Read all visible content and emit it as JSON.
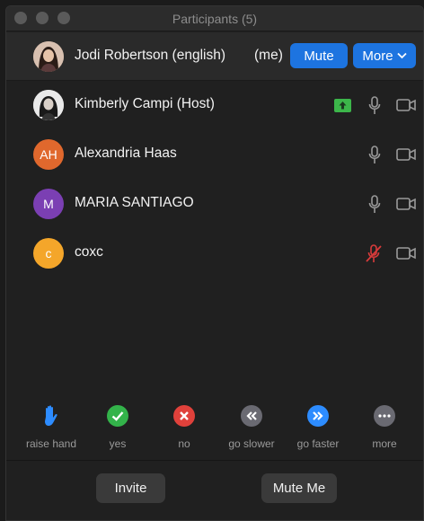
{
  "window": {
    "title": "Participants (5)"
  },
  "me": {
    "name": "Jodi Robertson (english)",
    "me_tag": "(me)",
    "mute_label": "Mute",
    "more_label": "More"
  },
  "participants": [
    {
      "name": "Kimberly Campi (Host)",
      "initials": "",
      "avatar": "photo",
      "sharing": true,
      "mic": "on",
      "video": "off"
    },
    {
      "name": "Alexandria Haas",
      "initials": "AH",
      "avatar_color": "#e0682d",
      "mic": "on",
      "video": "off"
    },
    {
      "name": "MARIA SANTIAGO",
      "initials": "M",
      "avatar_color": "#7b3fb3",
      "mic": "on",
      "video": "off"
    },
    {
      "name": "coxc",
      "initials": "c",
      "avatar_color": "#f4a62a",
      "mic": "muted",
      "video": "off"
    }
  ],
  "reactions": [
    {
      "label": "raise hand",
      "icon": "raise-hand-icon",
      "color": "#2d8cff"
    },
    {
      "label": "yes",
      "icon": "check-icon",
      "color": "#33b34a"
    },
    {
      "label": "no",
      "icon": "x-icon",
      "color": "#e0413b"
    },
    {
      "label": "go slower",
      "icon": "rewind-icon",
      "color": "#6a6a72"
    },
    {
      "label": "go faster",
      "icon": "fast-forward-icon",
      "color": "#2d8cff"
    },
    {
      "label": "more",
      "icon": "ellipsis-icon",
      "color": "#6a6a72"
    }
  ],
  "footer": {
    "invite_label": "Invite",
    "mute_me_label": "Mute Me"
  },
  "colors": {
    "accent": "#1d74e0",
    "share_green": "#3cb64a",
    "muted_red": "#d83b3b"
  }
}
